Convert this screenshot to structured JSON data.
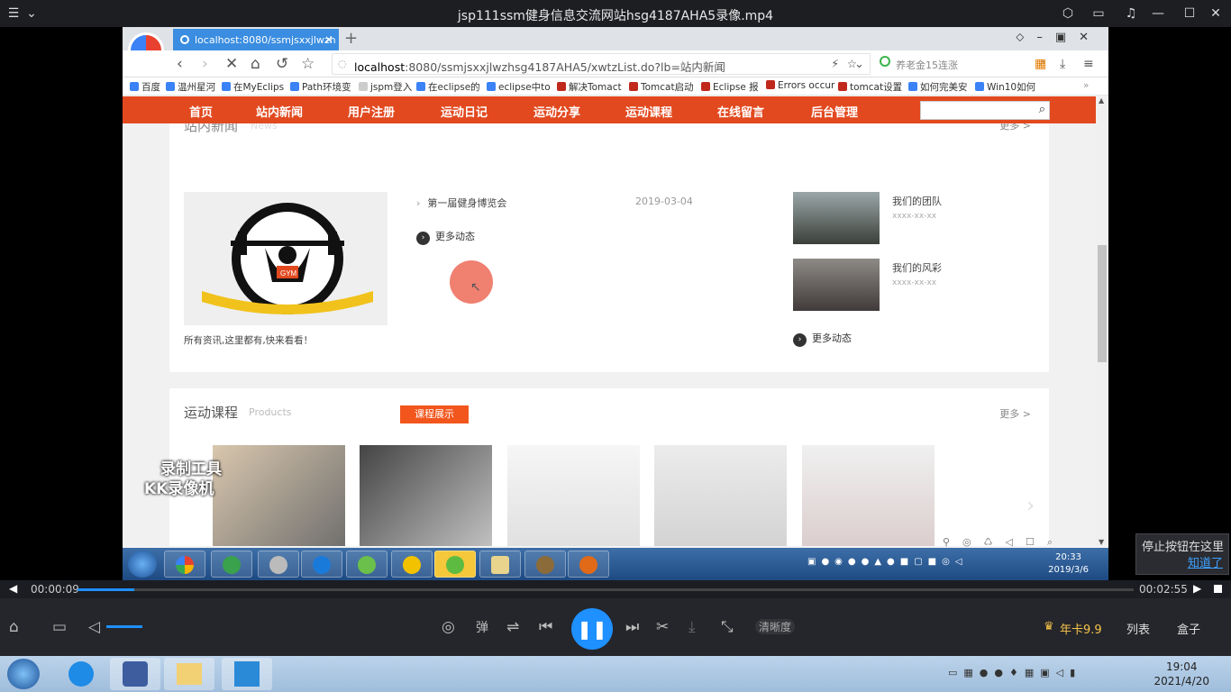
{
  "player": {
    "title": "jsp111ssm健身信息交流网站hsg4187AHA5录像.mp4",
    "time_current": "00:00:09",
    "time_total": "00:02:55",
    "progress": 0.054,
    "buttons": {
      "danmu": "弹",
      "quality": "清晰度",
      "vip": "年卡9.9",
      "list": "列表",
      "box": "盒子"
    },
    "tooltip": {
      "text": "停止按钮在这里",
      "link": "知道了"
    },
    "accent": "#1e90ff"
  },
  "browser": {
    "tab_title": "localhost:8080/ssmjsxxjlwzh",
    "url_host": "localhost",
    "url_rest": ":8080/ssmjsxxjlwzhsg4187AHA5/xwtzList.do?lb=站内新闻",
    "search_hint": "养老金15连涨",
    "bookmarks": [
      "百度",
      "温州星河",
      "在MyEclips",
      "Path环境变",
      "jspm登入",
      "在eclipse的",
      "eclipse中to",
      "解决Tomact",
      "Tomcat启动",
      "Eclipse 报",
      "Errors occur",
      "tomcat设置",
      "如何完美安",
      "Win10如何"
    ]
  },
  "site": {
    "nav": [
      "首页",
      "站内新闻",
      "用户注册",
      "运动日记",
      "运动分享",
      "运动课程",
      "在线留言",
      "后台管理"
    ],
    "nav_color": "#e2491f",
    "news": {
      "section_title": "站内新闻",
      "section_en": "News",
      "more": "更多 >",
      "logo_text": "GYM",
      "caption": "所有资讯,这里都有,快来看看！",
      "items": [
        {
          "title": "第一届健身博览会",
          "date": "2019-03-04"
        }
      ],
      "more_btn": "更多动态",
      "right": [
        {
          "title": "我们的团队",
          "date": "xxxx-xx-xx"
        },
        {
          "title": "我们的风彩",
          "date": "xxxx-xx-xx"
        }
      ],
      "right_more": "更多动态"
    },
    "courses": {
      "section_title": "运动课程",
      "section_en": "Products",
      "badge": "课程展示",
      "more": "更多 >"
    }
  },
  "recording": {
    "watermark_1": "录制工具",
    "watermark_2": "KK录像机",
    "clock_time": "20:33",
    "clock_date": "2019/3/6"
  },
  "windows": {
    "clock_time": "19:04",
    "clock_date": "2021/4/20"
  }
}
